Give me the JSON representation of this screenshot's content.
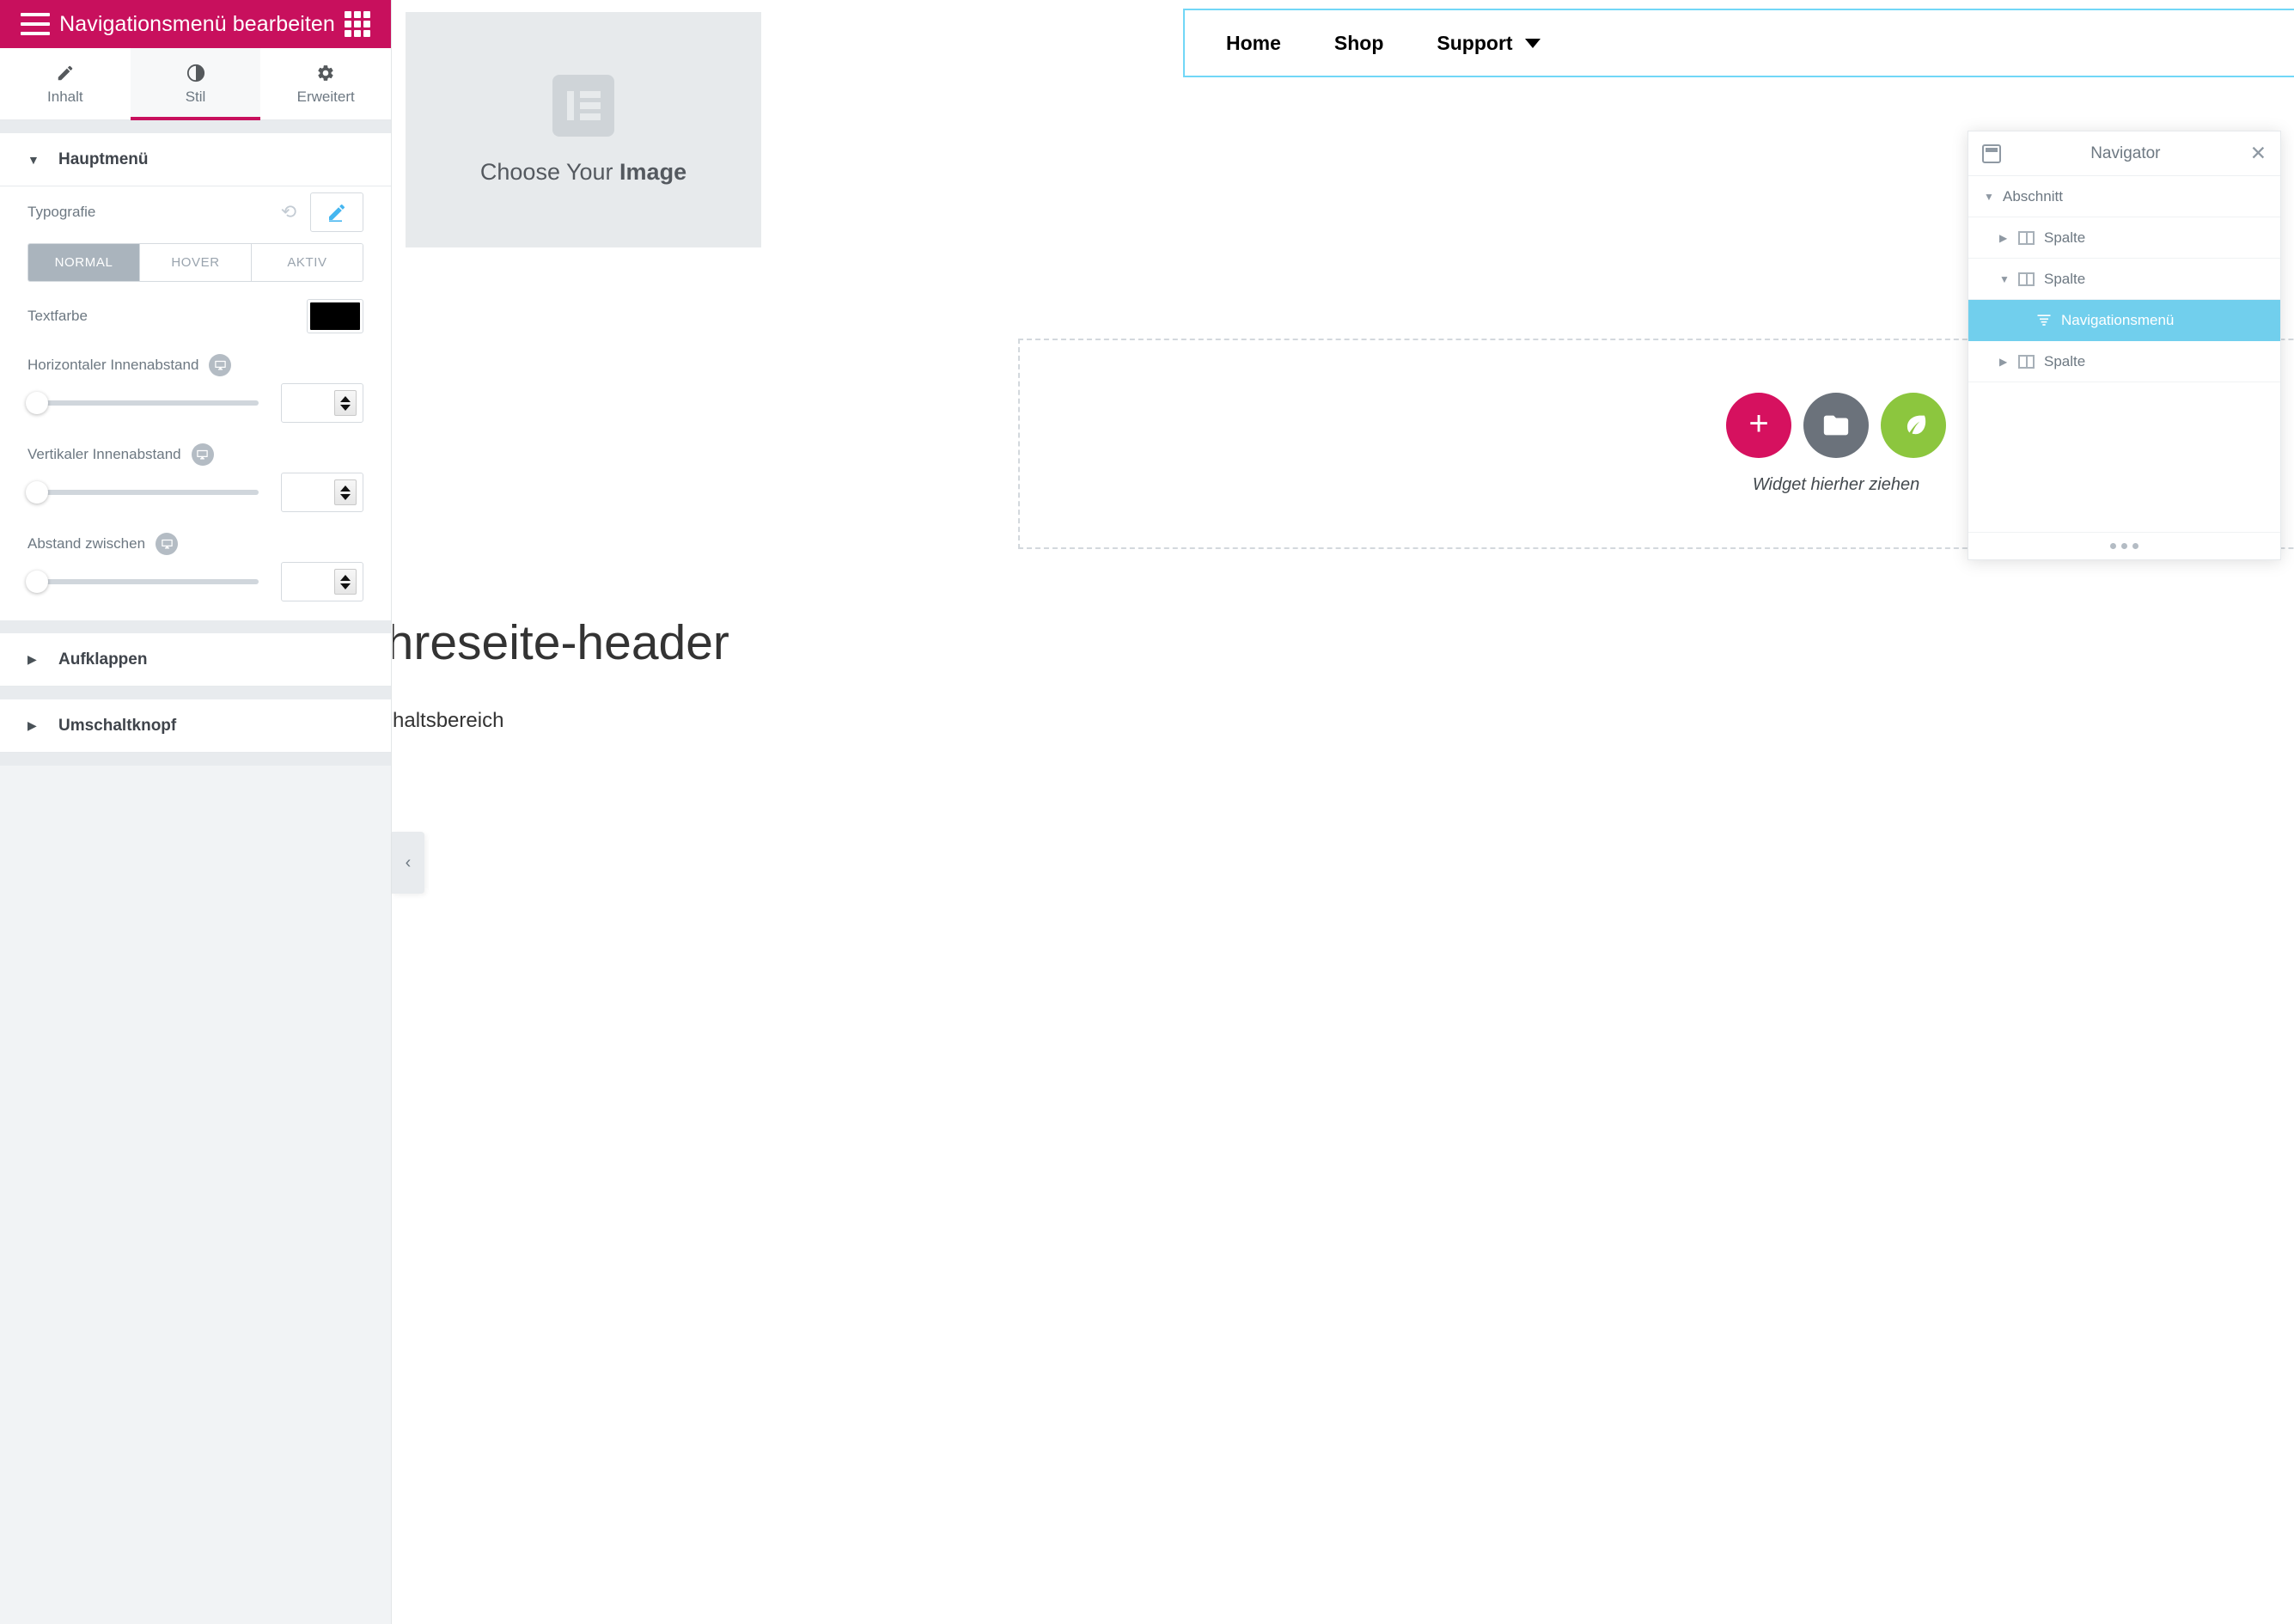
{
  "panel": {
    "header": {
      "title": "Navigationsmenü bearbeiten",
      "menu_icon": "hamburger-icon",
      "apps_icon": "grid-apps-icon"
    },
    "tabs": [
      {
        "label": "Inhalt",
        "icon": "pencil-icon",
        "active": false
      },
      {
        "label": "Stil",
        "icon": "contrast-icon",
        "active": true
      },
      {
        "label": "Erweitert",
        "icon": "gear-icon",
        "active": false
      }
    ],
    "sections": [
      {
        "title": "Hauptmenü",
        "expanded": true
      },
      {
        "title": "Aufklappen",
        "expanded": false
      },
      {
        "title": "Umschaltknopf",
        "expanded": false
      }
    ],
    "controls": {
      "typography_label": "Typografie",
      "typography_reset_icon": "reset-icon",
      "typography_edit_icon": "pencil-edit-icon",
      "state_tabs": [
        {
          "label": "NORMAL",
          "active": true
        },
        {
          "label": "HOVER",
          "active": false
        },
        {
          "label": "AKTIV",
          "active": false
        }
      ],
      "textcolor_label": "Textfarbe",
      "textcolor_value": "#000000",
      "sliders": [
        {
          "label": "Horizontaler Innenabstand",
          "device_icon": "desktop-icon",
          "value": "",
          "knob_percent": 0
        },
        {
          "label": "Vertikaler Innenabstand",
          "device_icon": "desktop-icon",
          "value": "",
          "knob_percent": 0
        },
        {
          "label": "Abstand zwischen",
          "device_icon": "desktop-icon",
          "value": "",
          "knob_percent": 0
        }
      ]
    },
    "collapse_icon": "chevron-left-icon"
  },
  "canvas": {
    "image_placeholder": {
      "text_plain": "Choose Your ",
      "text_bold": "Image",
      "logo_icon": "elementor-logo-icon"
    },
    "nav_menu": {
      "items": [
        {
          "label": "Home",
          "has_dropdown": false
        },
        {
          "label": "Shop",
          "has_dropdown": false
        },
        {
          "label": "Support",
          "has_dropdown": true
        }
      ]
    },
    "drop_zone": {
      "label": "Widget hierher ziehen",
      "buttons": [
        {
          "name": "add-widget-button",
          "icon": "plus-icon",
          "color": "#d6115f"
        },
        {
          "name": "add-template-button",
          "icon": "folder-icon",
          "color": "#6b727b"
        },
        {
          "name": "add-envato-button",
          "icon": "leaf-icon",
          "color": "#8cc63e"
        }
      ]
    },
    "page_heading": "ihreseite-header",
    "content_area_text": "Inhaltsbereich"
  },
  "navigator": {
    "title": "Navigator",
    "dock_icon": "dock-icon",
    "close_icon": "close-icon",
    "items": [
      {
        "label": "Abschnitt",
        "level": 1,
        "expanded": true,
        "icon": null,
        "selected": false
      },
      {
        "label": "Spalte",
        "level": 2,
        "expanded": false,
        "icon": "column-icon",
        "selected": false
      },
      {
        "label": "Spalte",
        "level": 2,
        "expanded": true,
        "icon": "column-icon",
        "selected": false
      },
      {
        "label": "Navigationsmenü",
        "level": 3,
        "expanded": null,
        "icon": "nav-menu-icon",
        "selected": true
      },
      {
        "label": "Spalte",
        "level": 2,
        "expanded": false,
        "icon": "column-icon",
        "selected": false
      }
    ],
    "footer_handle_icon": "drag-dots-icon"
  },
  "colors": {
    "brand_pink": "#c8105d",
    "accent_blue": "#71cfed",
    "selection_border": "#71d7f7",
    "green": "#8cc63e",
    "gray": "#6b727b"
  }
}
